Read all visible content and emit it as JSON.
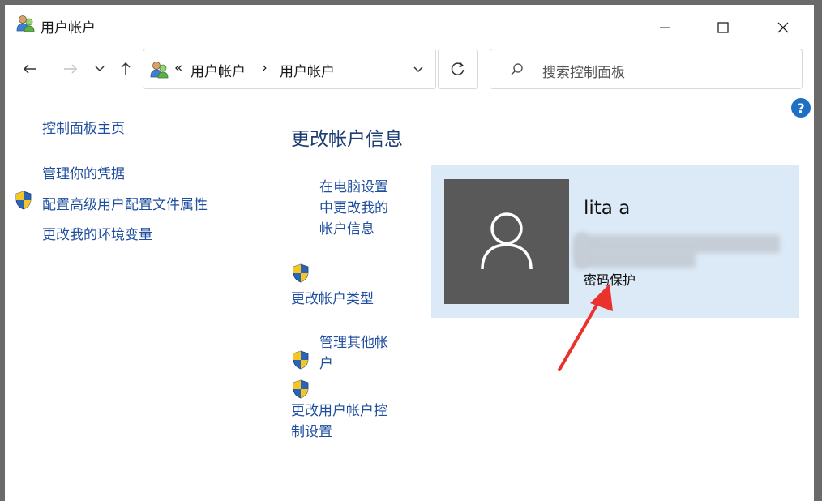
{
  "window": {
    "title": "用户帐户",
    "controls": {
      "minimize": "—",
      "maximize": "☐",
      "close": "✕"
    }
  },
  "nav": {
    "back": "←",
    "forward": "→",
    "recent": "⌄",
    "up": "↑"
  },
  "address": {
    "overflow": "«",
    "crumbs": [
      "用户帐户",
      "用户帐户"
    ],
    "separator": "›"
  },
  "search": {
    "placeholder": "搜索控制面板"
  },
  "help": {
    "label": "?"
  },
  "left_nav": {
    "home": "控制面板主页",
    "items": [
      "管理你的凭据",
      "配置高级用户配置文件属性",
      "更改我的环境变量"
    ]
  },
  "main": {
    "heading": "更改帐户信息",
    "tasks": {
      "pc_settings": [
        "在电脑设置",
        "中更改我的",
        "帐户信息"
      ],
      "change_type": "更改帐户类型",
      "manage_other": [
        "管理其他帐",
        "户"
      ],
      "uac": [
        "更改用户帐户控",
        "制设置"
      ]
    }
  },
  "user": {
    "name": "lita a",
    "protection": "密码保护"
  },
  "colors": {
    "link": "#1f4e9e",
    "heading": "#1e3d73",
    "card_bg": "#dce9f6",
    "avatar_bg": "#595959",
    "arrow": "#e8322b",
    "help": "#1f6fc5"
  }
}
